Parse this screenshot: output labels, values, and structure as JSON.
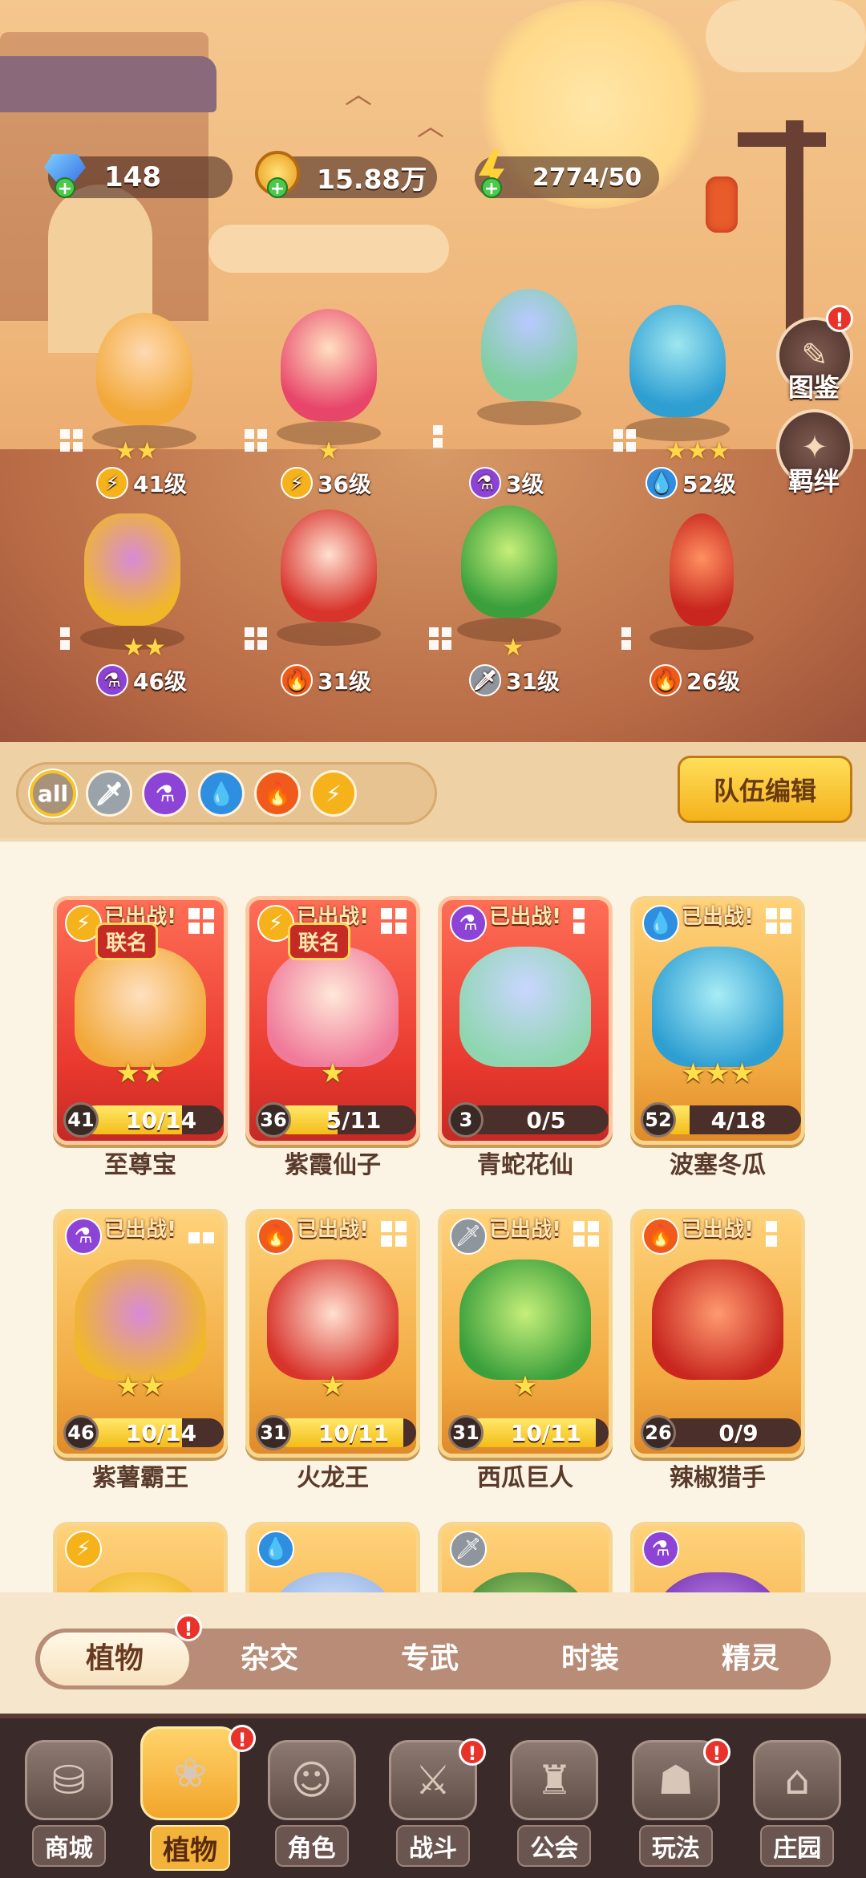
{
  "resources": {
    "gems": "148",
    "gold": "15.88万",
    "energy": "2774/50"
  },
  "side_buttons": {
    "codex": "图鉴",
    "bond": "羁绊",
    "codex_badge": "!"
  },
  "scene_heroes": [
    {
      "stars": "★★",
      "element": "lightning",
      "element_icon": "⚡",
      "level": "41级"
    },
    {
      "stars": "★",
      "element": "lightning",
      "element_icon": "⚡",
      "level": "36级"
    },
    {
      "stars": "",
      "element": "poison",
      "element_icon": "⚗",
      "level": "3级"
    },
    {
      "stars": "★★★",
      "element": "water",
      "element_icon": "💧",
      "level": "52级"
    },
    {
      "stars": "★★",
      "element": "poison",
      "element_icon": "⚗",
      "level": "46级"
    },
    {
      "stars": "",
      "element": "fire",
      "element_icon": "🔥",
      "level": "31级"
    },
    {
      "stars": "★",
      "element": "sword",
      "element_icon": "🗡",
      "level": "31级"
    },
    {
      "stars": "",
      "element": "fire",
      "element_icon": "🔥",
      "level": "26级"
    }
  ],
  "filter": {
    "all_label": "all",
    "icons": [
      "sword-filter-icon",
      "poison-filter-icon",
      "water-filter-icon",
      "fire-filter-icon",
      "lightning-filter-icon"
    ]
  },
  "team_edit_label": "队伍编辑",
  "cards": [
    {
      "name": "至尊宝",
      "deployed": "已出战!",
      "collab": "联名",
      "level": "41",
      "progress": "10/14",
      "ratio": 0.71,
      "stars": "★★",
      "color": "red",
      "element": "lightning"
    },
    {
      "name": "紫霞仙子",
      "deployed": "已出战!",
      "collab": "联名",
      "level": "36",
      "progress": "5/11",
      "ratio": 0.45,
      "stars": "★",
      "color": "red",
      "element": "lightning"
    },
    {
      "name": "青蛇花仙",
      "deployed": "已出战!",
      "collab": "",
      "level": "3",
      "progress": "0/5",
      "ratio": 0.0,
      "stars": "",
      "color": "red",
      "element": "poison"
    },
    {
      "name": "波塞冬瓜",
      "deployed": "已出战!",
      "collab": "",
      "level": "52",
      "progress": "4/18",
      "ratio": 0.22,
      "stars": "★★★",
      "color": "gold",
      "element": "water"
    },
    {
      "name": "紫薯霸王",
      "deployed": "已出战!",
      "collab": "",
      "level": "46",
      "progress": "10/14",
      "ratio": 0.71,
      "stars": "★★",
      "color": "gold",
      "element": "poison"
    },
    {
      "name": "火龙王",
      "deployed": "已出战!",
      "collab": "",
      "level": "31",
      "progress": "10/11",
      "ratio": 0.91,
      "stars": "★",
      "color": "gold",
      "element": "fire"
    },
    {
      "name": "西瓜巨人",
      "deployed": "已出战!",
      "collab": "",
      "level": "31",
      "progress": "10/11",
      "ratio": 0.91,
      "stars": "★",
      "color": "gold",
      "element": "sword"
    },
    {
      "name": "辣椒猎手",
      "deployed": "已出战!",
      "collab": "",
      "level": "26",
      "progress": "0/9",
      "ratio": 0.0,
      "stars": "",
      "color": "gold",
      "element": "fire"
    }
  ],
  "sub_tabs": [
    "植物",
    "杂交",
    "专武",
    "时装",
    "精灵"
  ],
  "nav": [
    "商城",
    "植物",
    "角色",
    "战斗",
    "公会",
    "玩法",
    "庄园"
  ],
  "colors": {
    "accent_gold": "#f4b21c",
    "badge_red": "#e8322a",
    "card_red": "#e8382e",
    "card_gold": "#f1a940"
  }
}
